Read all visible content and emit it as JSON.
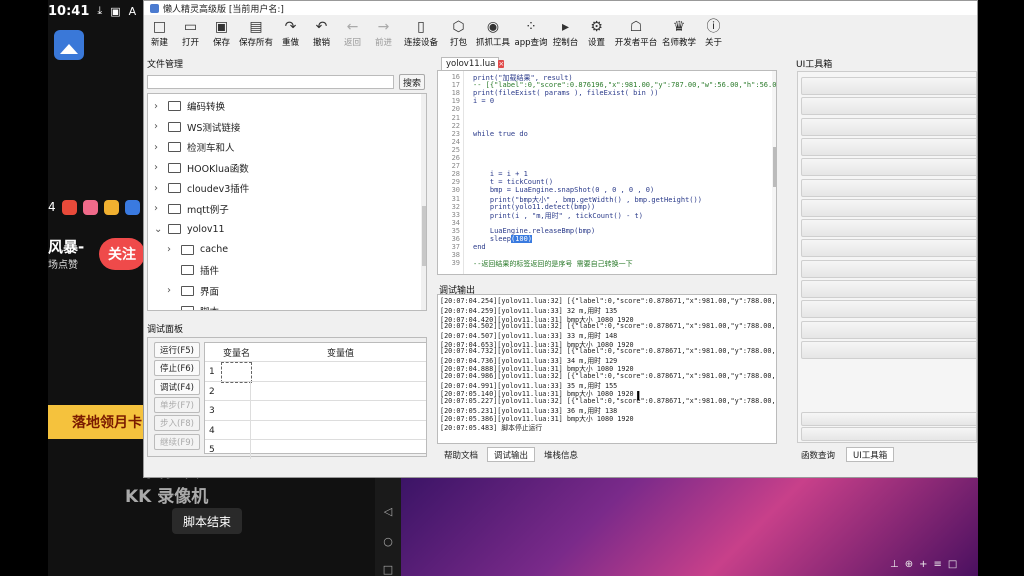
{
  "status_bar": {
    "time": "10:41"
  },
  "phone_bg": {
    "app_row_text": "4",
    "live_title": "风暴-",
    "live_sub": "场点赞",
    "follow_label": "关注",
    "banner_text": "落地领月卡",
    "recorder_line1": "录制工具",
    "recorder_line2": "KK 录像机",
    "toast_text": "脚本结束"
  },
  "window": {
    "title": "懒人精灵高级版 [当前用户名:]"
  },
  "toolbar": [
    {
      "label": "新建",
      "icon": "□",
      "name": "new",
      "enabled": true
    },
    {
      "label": "打开",
      "icon": "▭",
      "name": "open",
      "enabled": true
    },
    {
      "label": "保存",
      "icon": "▣",
      "name": "save",
      "enabled": true
    },
    {
      "label": "保存所有",
      "icon": "▤",
      "name": "save-all",
      "enabled": true
    },
    {
      "label": "重做",
      "icon": "↷",
      "name": "redo",
      "enabled": true
    },
    {
      "label": "撤销",
      "icon": "↶",
      "name": "undo",
      "enabled": true
    },
    {
      "label": "返回",
      "icon": "←",
      "name": "back",
      "enabled": false
    },
    {
      "label": "前进",
      "icon": "→",
      "name": "forward",
      "enabled": false
    },
    {
      "label": "连接设备",
      "icon": "▯",
      "name": "connect-device",
      "enabled": true
    },
    {
      "label": "打包",
      "icon": "⬡",
      "name": "package",
      "enabled": true
    },
    {
      "label": "抓抓工具",
      "icon": "◉",
      "name": "capture-tool",
      "enabled": true
    },
    {
      "label": "app查询",
      "icon": "⁘",
      "name": "app-query",
      "enabled": true
    },
    {
      "label": "控制台",
      "icon": "▸",
      "name": "console",
      "enabled": true
    },
    {
      "label": "设置",
      "icon": "⚙",
      "name": "settings",
      "enabled": true
    },
    {
      "label": "开发者平台",
      "icon": "☖",
      "name": "developer-platform",
      "enabled": true
    },
    {
      "label": "名师教学",
      "icon": "♛",
      "name": "teaching",
      "enabled": true
    },
    {
      "label": "关于",
      "icon": "ⓘ",
      "name": "about",
      "enabled": true
    }
  ],
  "file_manager": {
    "title": "文件管理",
    "search_button": "搜索",
    "items": [
      {
        "label": "编码转换",
        "level": 0,
        "expanded": false
      },
      {
        "label": "WS测试链接",
        "level": 0,
        "expanded": false
      },
      {
        "label": "检测车和人",
        "level": 0,
        "expanded": false
      },
      {
        "label": "HOOKlua函数",
        "level": 0,
        "expanded": false
      },
      {
        "label": "cloudev3插件",
        "level": 0,
        "expanded": false
      },
      {
        "label": "mqtt例子",
        "level": 0,
        "expanded": false
      },
      {
        "label": "yolov11",
        "level": 0,
        "expanded": true
      },
      {
        "label": "cache",
        "level": 1,
        "expanded": false
      },
      {
        "label": "插件",
        "level": 1,
        "expanded": null
      },
      {
        "label": "界面",
        "level": 1,
        "expanded": false
      },
      {
        "label": "脚本",
        "level": 1,
        "expanded": true
      }
    ]
  },
  "debug_panel": {
    "title": "调试面板",
    "buttons": [
      {
        "label": "运行(F5)",
        "enabled": true
      },
      {
        "label": "停止(F6)",
        "enabled": true
      },
      {
        "label": "调试(F4)",
        "enabled": true
      },
      {
        "label": "单步(F7)",
        "enabled": false
      },
      {
        "label": "步入(F8)",
        "enabled": false
      },
      {
        "label": "继续(F9)",
        "enabled": false
      }
    ],
    "columns": [
      "变量名",
      "变量值"
    ],
    "rows": [
      "1",
      "2",
      "3",
      "4",
      "5"
    ]
  },
  "editor": {
    "tab": "yolov11.lua",
    "lines": [
      {
        "n": "16",
        "text": "print(\"加载结果\", result)"
      },
      {
        "n": "17",
        "text": "-- [{\"label\":0,\"score\":0.876196,\"x\":981.00,\"y\":787.00,\"w\":56.00,\"h\":56.00}]",
        "comment": true
      },
      {
        "n": "18",
        "text": "print(fileExist( params ), fileExist( bin ))"
      },
      {
        "n": "19",
        "text": "i = 0"
      },
      {
        "n": "20",
        "text": ""
      },
      {
        "n": "21",
        "text": ""
      },
      {
        "n": "22",
        "text": ""
      },
      {
        "n": "23",
        "text": "while true do"
      },
      {
        "n": "24",
        "text": ""
      },
      {
        "n": "25",
        "text": ""
      },
      {
        "n": "26",
        "text": ""
      },
      {
        "n": "27",
        "text": ""
      },
      {
        "n": "28",
        "text": "    i = i + 1"
      },
      {
        "n": "29",
        "text": "    t = tickCount()"
      },
      {
        "n": "30",
        "text": "    bmp = LuaEngine.snapShot(0 , 0 , 0 , 0)"
      },
      {
        "n": "31",
        "text": "    print(\"bmp大小\" , bmp.getWidth() , bmp.getHeight())"
      },
      {
        "n": "32",
        "text": "    print(yolo11.detect(bmp))"
      },
      {
        "n": "33",
        "text": "    print(i , \"m,用时\" , tickCount() - t)"
      },
      {
        "n": "34",
        "text": ""
      },
      {
        "n": "35",
        "text": "    LuaEngine.releaseBmp(bmp)"
      },
      {
        "n": "36",
        "text": "    sleep(100)"
      },
      {
        "n": "37",
        "text": "end"
      },
      {
        "n": "38",
        "text": ""
      },
      {
        "n": "39",
        "text": "--返回结果的标签返回的是序号 需要自己转换一下",
        "comment": true
      }
    ]
  },
  "output": {
    "title": "调试输出",
    "lines": [
      "[20:07:04.254][yolov11.lua:32] [{\"label\":0,\"score\":0.878671,\"x\":981.00,\"y\":788.00,\"w\":",
      "[20:07:04.259][yolov11.lua:33] 32 m,用时 135",
      "[20:07:04.420][yolov11.lua:31] bmp大小 1080 1920",
      "[20:07:04.502][yolov11.lua:32] [{\"label\":0,\"score\":0.878671,\"x\":981.00,\"y\":788.00,\"w\":",
      "[20:07:04.507][yolov11.lua:33] 33 m,用时 148",
      "[20:07:04.653][yolov11.lua:31] bmp大小 1080 1920",
      "[20:07:04.732][yolov11.lua:32] [{\"label\":0,\"score\":0.878671,\"x\":981.00,\"y\":788.00,\"w\":",
      "[20:07:04.736][yolov11.lua:33] 34 m,用时 129",
      "[20:07:04.888][yolov11.lua:31] bmp大小 1080 1920",
      "[20:07:04.986][yolov11.lua:32] [{\"label\":0,\"score\":0.878671,\"x\":981.00,\"y\":788.00,\"w\":",
      "[20:07:04.991][yolov11.lua:33] 35 m,用时 155",
      "[20:07:05.140][yolov11.lua:31] bmp大小 1080 1920",
      "[20:07:05.227][yolov11.lua:32] [{\"label\":0,\"score\":0.878671,\"x\":981.00,\"y\":788.00,\"w\":",
      "[20:07:05.231][yolov11.lua:33] 36 m,用时 138",
      "[20:07:05.386][yolov11.lua:31] bmp大小 1080 1920",
      "[20:07:05.483] 脚本停止运行"
    ],
    "tabs": [
      {
        "label": "帮助文档",
        "active": false
      },
      {
        "label": "调试输出",
        "active": true
      },
      {
        "label": "堆栈信息",
        "active": false
      }
    ]
  },
  "ui_toolbox": {
    "title": "UI工具箱",
    "tabs": [
      {
        "label": "函数查询",
        "active": false
      },
      {
        "label": "UI工具箱",
        "active": true
      }
    ]
  }
}
